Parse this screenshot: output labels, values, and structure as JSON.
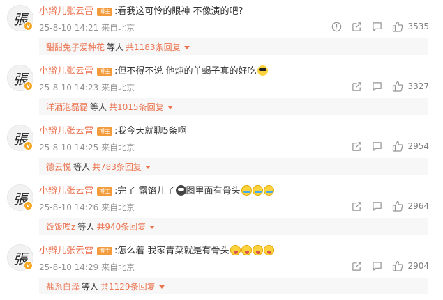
{
  "comments": [
    {
      "username": "小辫儿张云雷",
      "tag": "博主",
      "text": ":看我这可怜的眼神 不像演的吧?",
      "emojis": [],
      "time": "25-8-10 14:21",
      "location": "来自北京",
      "likes": "3535",
      "reply_user": "甜甜兔子爱种花",
      "reply_mid": "等人",
      "reply_count": "共1183条回复",
      "has_report": true
    },
    {
      "username": "小辫儿张云雷",
      "tag": "博主",
      "text": ":但不得不说 他炖的羊蝎子真的好吃",
      "emojis": [
        "cool"
      ],
      "time": "25-8-10 14:23",
      "location": "来自北京",
      "likes": "3327",
      "reply_user": "洋酒泡磊磊",
      "reply_mid": "等人",
      "reply_count": "共1015条回复",
      "has_report": false
    },
    {
      "username": "小辫儿张云雷",
      "tag": "博主",
      "text": ":我今天就聊5条啊",
      "emojis": [],
      "time": "25-8-10 14:25",
      "location": "来自北京",
      "likes": "2954",
      "reply_user": "德云悦",
      "reply_mid": "等人",
      "reply_count": "共783条回复",
      "has_report": false
    },
    {
      "username": "小辫儿张云雷",
      "tag": "博主",
      "text": ":完了 露馅儿了",
      "text2": "图里面有骨头",
      "emojis": [
        "ghost"
      ],
      "emojis2": [
        "cry",
        "cry",
        "cry"
      ],
      "time": "25-8-10 14:26",
      "location": "来自北京",
      "likes": "2964",
      "reply_user": "饭饭唉z",
      "reply_mid": "等人",
      "reply_count": "共940条回复",
      "has_report": false
    },
    {
      "username": "小辫儿张云雷",
      "tag": "博主",
      "text": ":怎么着 我家青菜就是有骨头",
      "emojis": [
        "laugh",
        "laugh",
        "laugh",
        "laugh"
      ],
      "time": "25-8-10 14:29",
      "location": "来自北京",
      "likes": "2904",
      "reply_user": "盐系白泽",
      "reply_mid": "等人",
      "reply_count": "共1129条回复",
      "has_report": false
    }
  ],
  "avatar_glyph": "張",
  "verified_badge": "v",
  "icons": {
    "report": "report-icon",
    "share": "share-icon",
    "comment": "comment-icon",
    "like": "like-icon"
  },
  "colors": {
    "username": "#eb7350",
    "tag_bg": "#f39b3b",
    "meta": "#939393",
    "reply_bg": "#f7f7f7"
  }
}
